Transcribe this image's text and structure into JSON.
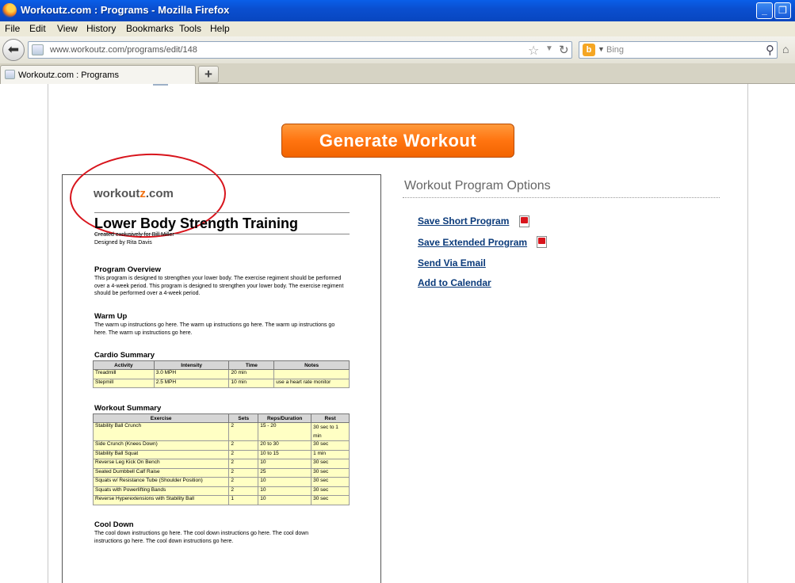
{
  "window": {
    "title": "Workoutz.com : Programs - Mozilla Firefox",
    "minimize": "_",
    "restore": "❐"
  },
  "menu": [
    "File",
    "Edit",
    "View",
    "History",
    "Bookmarks",
    "Tools",
    "Help"
  ],
  "nav": {
    "url": "www.workoutz.com/programs/edit/148",
    "search_placeholder": "Bing"
  },
  "tab": {
    "label": "Workoutz.com : Programs",
    "new_tab": "+"
  },
  "page": {
    "generate_button": "Generate Workout",
    "preview": {
      "logo_part1": "workout",
      "logo_z": "z",
      "logo_part2": ".com",
      "title": "Lower Body Strength Training",
      "created_for": "Created exclusively for Bill Miller",
      "designed_by": "Designed by Rita Davis",
      "overview_heading": "Program Overview",
      "overview_text": "This program is designed to strengthen your lower body. The exercise regiment should be performed over a 4-week period. This program is designed to strengthen your lower body. The exercise regiment should be performed over a 4-week period.",
      "warmup_heading": "Warm Up",
      "warmup_text": "The warm up instructions go here. The warm up instructions go here. The warm up instructions go here. The warm up instructions go here.",
      "cardio_heading": "Cardio Summary",
      "cardio_columns": [
        "Activity",
        "Intensity",
        "Time",
        "Notes"
      ],
      "cardio_rows": [
        [
          "Treadmill",
          "3.0 MPH",
          "20 min",
          ""
        ],
        [
          "Stepmill",
          "2.5 MPH",
          "10 min",
          "use a heart rate monitor"
        ]
      ],
      "workout_heading": "Workout Summary",
      "workout_columns": [
        "Exercise",
        "Sets",
        "Reps/Duration",
        "Rest"
      ],
      "workout_rows": [
        [
          "Stability Ball Crunch",
          "2",
          "15 - 20",
          "30 sec to 1 min"
        ],
        [
          "Side Crunch (Knees Down)",
          "2",
          "20 to 30",
          "30 sec"
        ],
        [
          "Stability Ball Squat",
          "2",
          "10 to 15",
          "1 min"
        ],
        [
          "Reverse Leg Kick On Bench",
          "2",
          "10",
          "30 sec"
        ],
        [
          "Seated Dumbbell Calf Raise",
          "2",
          "25",
          "30 sec"
        ],
        [
          "Squats w/ Resistance Tube (Shoulder Position)",
          "2",
          "10",
          "30 sec"
        ],
        [
          "Squats with Powerlifting Bands",
          "2",
          "10",
          "30 sec"
        ],
        [
          "Reverse Hyperextensions with Stability Ball",
          "1",
          "10",
          "30 sec"
        ]
      ],
      "cooldown_heading": "Cool Down",
      "cooldown_text": "The cool down instructions go here. The cool down instructions go here. The cool down instructions go here. The cool down instructions go here."
    },
    "options": {
      "title": "Workout Program Options",
      "save_short": "Save Short Program",
      "save_extended": "Save Extended Program",
      "send_email": "Send Via Email",
      "add_calendar": "Add to Calendar"
    }
  }
}
